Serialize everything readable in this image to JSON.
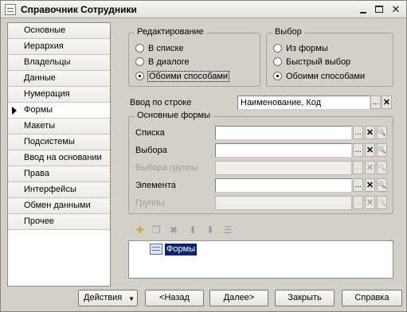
{
  "window": {
    "title": "Справочник Сотрудники"
  },
  "nav": {
    "items": [
      {
        "label": "Основные"
      },
      {
        "label": "Иерархия"
      },
      {
        "label": "Владельцы"
      },
      {
        "label": "Данные"
      },
      {
        "label": "Нумерация"
      },
      {
        "label": "Формы",
        "active": true
      },
      {
        "label": "Макеты"
      },
      {
        "label": "Подсистемы"
      },
      {
        "label": "Ввод на основании"
      },
      {
        "label": "Права"
      },
      {
        "label": "Интерфейсы"
      },
      {
        "label": "Обмен данными"
      },
      {
        "label": "Прочее"
      }
    ]
  },
  "editing": {
    "title": "Редактирование",
    "options": [
      "В списке",
      "В диалоге",
      "Обоими способами"
    ],
    "selected": "Обоими способами"
  },
  "selection": {
    "title": "Выбор",
    "options": [
      "Из формы",
      "Быстрый выбор",
      "Обоими способами"
    ],
    "selected": "Обоими способами"
  },
  "line_input": {
    "label": "Ввод по строке",
    "value": "Наименование, Код"
  },
  "main_forms": {
    "title": "Основные формы",
    "fields": [
      {
        "label": "Списка",
        "value": "",
        "enabled": true
      },
      {
        "label": "Выбора",
        "value": "",
        "enabled": true
      },
      {
        "label": "Выбора группы",
        "value": "",
        "enabled": false
      },
      {
        "label": "Элемента",
        "value": "",
        "enabled": true
      },
      {
        "label": "Группы",
        "value": "",
        "enabled": false
      }
    ]
  },
  "toolbar": {
    "icons": [
      "add-icon",
      "copy-icon",
      "delete-icon",
      "move-up-icon",
      "move-down-icon",
      "sort-icon"
    ]
  },
  "tree": {
    "root_label": "Формы"
  },
  "buttons": {
    "actions": "Действия",
    "back": "<Назад",
    "next": "Далее>",
    "close": "Закрыть",
    "help": "Справка"
  },
  "glyphs": {
    "ellipsis": "...",
    "clear": "✕",
    "search": "🔍"
  }
}
